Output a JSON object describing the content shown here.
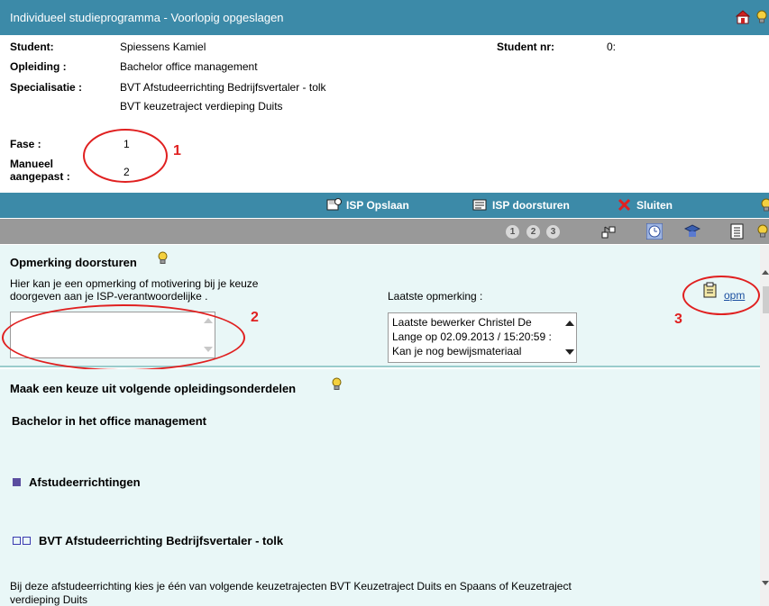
{
  "header": {
    "title": "Individueel studieprogramma   - Voorlopig opgeslagen"
  },
  "student": {
    "student_label": "Student:",
    "student_value": "Spiessens Kamiel",
    "studentnr_label": "Student nr:",
    "studentnr_value": "0:",
    "opleiding_label": "Opleiding :",
    "opleiding_value": "Bachelor office management",
    "specialisatie_label": "Specialisatie :",
    "specialisatie_value1": "BVT Afstudeerrichting Bedrijfsvertaler - tolk",
    "specialisatie_value2": "BVT keuzetraject verdieping Duits",
    "fase_label": "Fase :",
    "fase_value": "1",
    "manueel_label1": "Manueel",
    "manueel_label2": "aangepast :",
    "manueel_value": "2"
  },
  "actions": {
    "save": "ISP Opslaan",
    "forward": "ISP doorsturen",
    "close": "Sluiten"
  },
  "steps": [
    "1",
    "2",
    "3"
  ],
  "opmerking": {
    "title": "Opmerking doorsturen",
    "help1": "Hier kan je een opmerking of motivering bij je keuze",
    "help2": "doorgeven aan je ISP-verantwoordelijke .",
    "input_value": "",
    "last_label": "Laatste opmerking :",
    "last_line1": "Laatste bewerker Christel De",
    "last_line2": "Lange op 02.09.2013 / 15:20:59 :",
    "last_line3": "Kan je nog bewijsmateriaal",
    "opm_link": "opm"
  },
  "keuze": {
    "title": "Maak een keuze uit volgende opleidingsonderdelen",
    "program": "Bachelor in het office management",
    "section": "Afstudeerrichtingen",
    "option": "BVT Afstudeerrichting Bedrijfsvertaler - tolk",
    "desc1": "Bij deze afstudeerrichting kies je één van volgende keuzetrajecten BVT Keuzetraject Duits en Spaans of Keuzetraject",
    "desc2": "verdieping Duits"
  },
  "annotations": [
    "1",
    "2",
    "3"
  ],
  "colors": {
    "bar": "#3c8aa8",
    "navbar": "#999999",
    "panel": "#e9f7f7",
    "annotation": "#e02020"
  }
}
